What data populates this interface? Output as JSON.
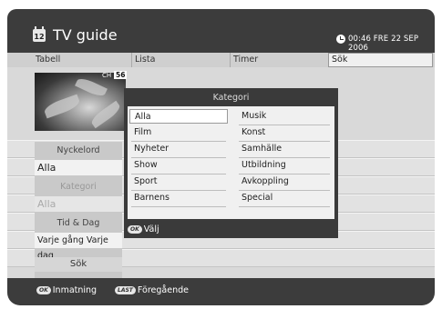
{
  "header": {
    "icon_label": "12",
    "title": "TV guide",
    "datetime": "00:46 FRE 22 SEP 2006"
  },
  "tabs": [
    "Tabell",
    "Lista",
    "Timer",
    "Sök"
  ],
  "preview": {
    "ch_label": "CH",
    "ch_number": "56"
  },
  "left_panel": {
    "keyword_label": "Nyckelord",
    "keyword_value": "Alla",
    "category_label": "Kategori",
    "category_value": "Alla",
    "time_label": "Tid & Dag",
    "time_value": "Varje gång Varje dag",
    "search_button": "Sök"
  },
  "category_popup": {
    "title": "Kategori",
    "left_items": [
      "Alla",
      "Film",
      "Nyheter",
      "Show",
      "Sport",
      "Barnens"
    ],
    "right_items": [
      "Musik",
      "Konst",
      "Samhälle",
      "Utbildning",
      "Avkoppling",
      "Special"
    ],
    "selected": "Alla",
    "footer_key": "OK",
    "footer_label": "Välj"
  },
  "footer": {
    "ok_key": "OK",
    "ok_label": "Inmatning",
    "last_key": "LAST",
    "last_label": "Föregående"
  }
}
